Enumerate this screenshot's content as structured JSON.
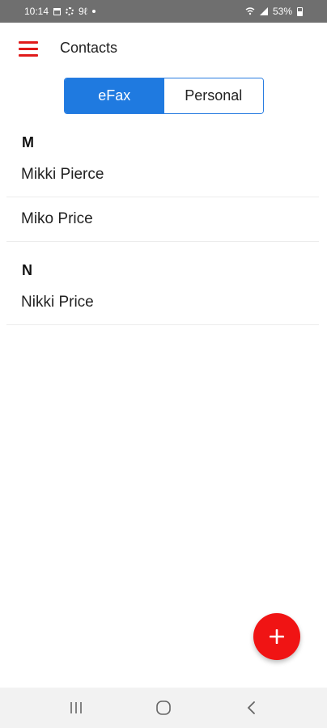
{
  "status_bar": {
    "time": "10:14",
    "notifications_text": "9ℓ",
    "battery": "53%"
  },
  "app_bar": {
    "menu_icon": "hamburger-menu-icon",
    "title": "Contacts",
    "accent_color": "#e01b1b"
  },
  "tabs": [
    {
      "label": "eFax",
      "selected": true
    },
    {
      "label": "Personal",
      "selected": false
    }
  ],
  "sections": [
    {
      "letter": "M",
      "contacts": [
        "Mikki Pierce",
        "Miko Price"
      ]
    },
    {
      "letter": "N",
      "contacts": [
        "Nikki Price"
      ]
    }
  ],
  "fab": {
    "icon": "plus-icon",
    "color": "#f01414"
  },
  "nav_bar": {
    "recents_icon": "recents-icon",
    "home_icon": "home-icon",
    "back_icon": "back-icon"
  }
}
